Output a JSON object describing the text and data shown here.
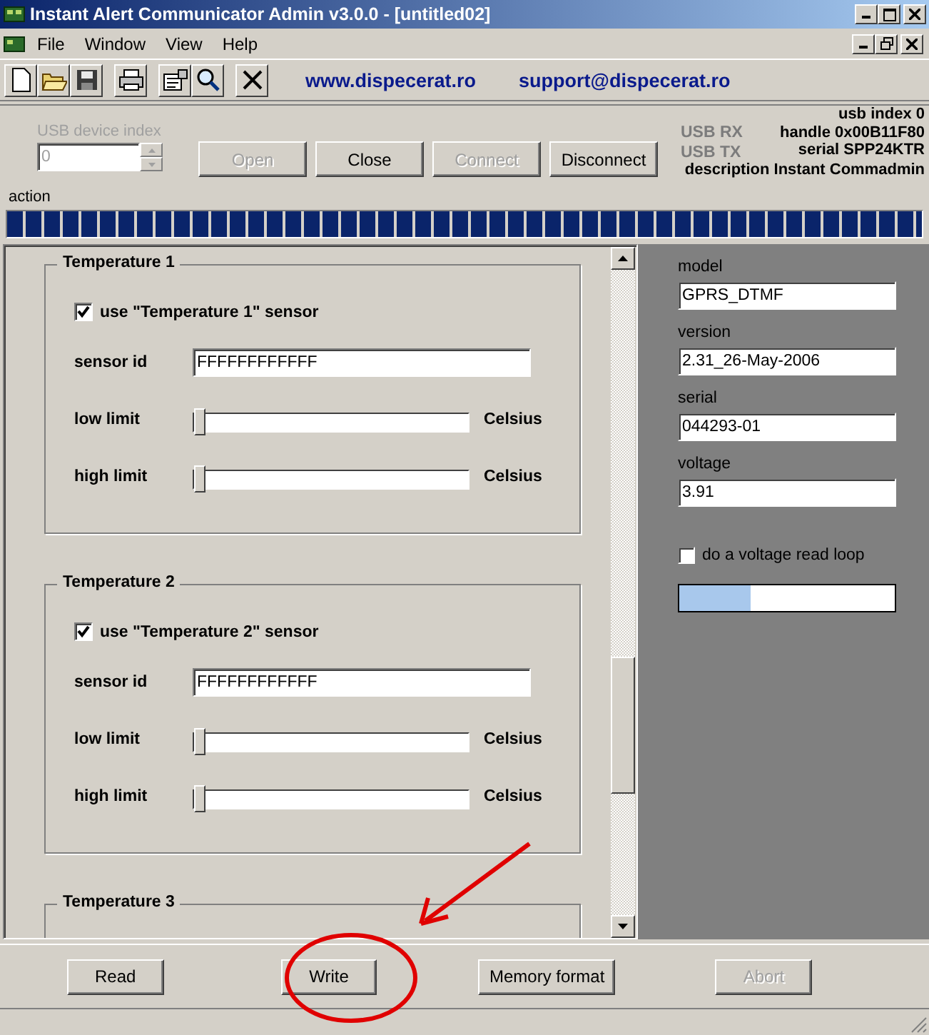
{
  "window": {
    "title": "Instant Alert Communicator Admin v3.0.0 - [untitled02]"
  },
  "menu": [
    "File",
    "Window",
    "View",
    "Help"
  ],
  "toolbar": {
    "links": [
      "www.dispecerat.ro",
      "support@dispecerat.ro"
    ]
  },
  "usb": {
    "device_index": {
      "label": "USB device index",
      "value": "0",
      "disabled": true
    },
    "buttons": [
      {
        "label": "Open",
        "disabled": true
      },
      {
        "label": "Close",
        "disabled": false
      },
      {
        "label": "Connect",
        "disabled": true
      },
      {
        "label": "Disconnect",
        "disabled": false
      }
    ],
    "indicators": [
      {
        "label": "USB RX",
        "on": false
      },
      {
        "label": "USB TX",
        "on": false
      }
    ],
    "info": [
      "usb index 0",
      "handle 0x00B11F80",
      "serial SPP24KTR",
      "description Instant Commadmin"
    ]
  },
  "action": {
    "label": "action",
    "level": 1
  },
  "temperatures": [
    {
      "title": "Temperature 1",
      "use": {
        "label": "use \"Temperature 1\" sensor",
        "checked": true
      },
      "sensor_id": {
        "label": "sensor id",
        "value": "FFFFFFFFFFFF"
      },
      "limits": [
        {
          "label": "low limit",
          "level": 0,
          "unit": "Celsius"
        },
        {
          "label": "high limit",
          "level": 0,
          "unit": "Celsius"
        }
      ]
    },
    {
      "title": "Temperature 2",
      "use": {
        "label": "use \"Temperature 2\" sensor",
        "checked": true
      },
      "sensor_id": {
        "label": "sensor id",
        "value": "FFFFFFFFFFFF"
      },
      "limits": [
        {
          "label": "low limit",
          "level": 0,
          "unit": "Celsius"
        },
        {
          "label": "high limit",
          "level": 0,
          "unit": "Celsius"
        }
      ]
    },
    {
      "title": "Temperature 3"
    }
  ],
  "device": {
    "fields": [
      {
        "label": "model",
        "value": "GPRS_DTMF"
      },
      {
        "label": "version",
        "value": "2.31_26-May-2006"
      },
      {
        "label": "serial",
        "value": "044293-01"
      },
      {
        "label": "voltage",
        "value": "3.91"
      }
    ],
    "loop": {
      "label": "do a voltage read loop",
      "checked": false
    },
    "level": 0.33
  },
  "buttons": [
    {
      "label": "Read",
      "disabled": false
    },
    {
      "label": "Write",
      "disabled": false
    },
    {
      "label": "Memory format",
      "disabled": false
    },
    {
      "label": "Abort",
      "disabled": true
    }
  ]
}
